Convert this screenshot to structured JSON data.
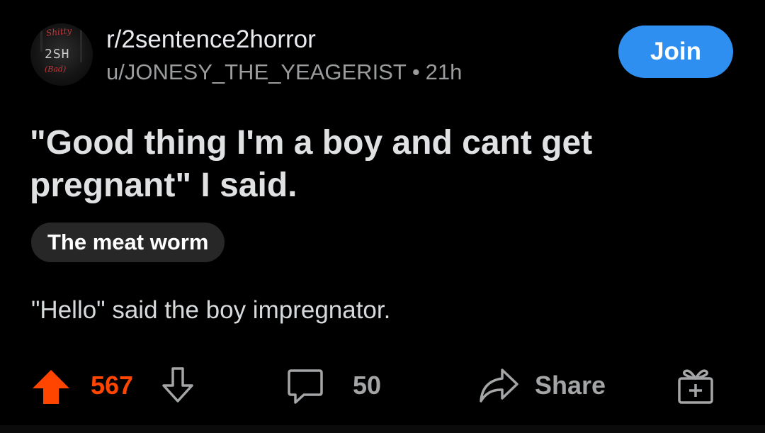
{
  "header": {
    "subreddit": "r/2sentence2horror",
    "author": "u/JONESY_THE_YEAGERIST",
    "separator": "•",
    "age": "21h",
    "join_label": "Join",
    "avatar_text": {
      "top": "Shitty",
      "middle": "2SH",
      "bottom": "(Bad)"
    }
  },
  "post": {
    "title": "\"Good thing I'm a boy and cant get pregnant\" I said.",
    "flair": "The meat worm",
    "body": "\"Hello\" said the boy impregnator."
  },
  "actions": {
    "score": "567",
    "comment_count": "50",
    "share_label": "Share",
    "icons": [
      "upvote-icon",
      "downvote-icon",
      "comment-icon",
      "share-icon",
      "award-icon"
    ]
  },
  "colors": {
    "background": "#000000",
    "join_button": "#2f8ff0",
    "upvote_active": "#ff4500",
    "flair_bg": "#272727",
    "muted_text": "#9a9c9e"
  }
}
